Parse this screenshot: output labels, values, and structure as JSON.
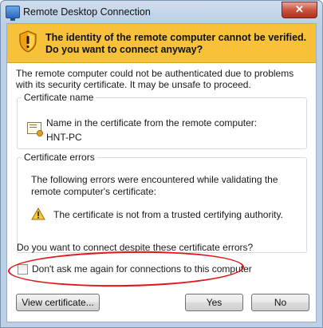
{
  "window": {
    "title": "Remote Desktop Connection",
    "close_glyph": "✕"
  },
  "banner": {
    "text": "The identity of the remote computer cannot be verified. Do you want to connect anyway?",
    "icon": "warning-shield-icon",
    "color": "#f7c23a"
  },
  "intro": "The remote computer could not be authenticated due to problems with its security certificate. It may be unsafe to proceed.",
  "certificate_name": {
    "legend": "Certificate name",
    "label": "Name in the certificate from the remote computer:",
    "value": "HNT-PC"
  },
  "certificate_errors": {
    "legend": "Certificate errors",
    "description": "The following errors were encountered while validating the remote computer's certificate:",
    "error": "The certificate is not from a trusted certifying authority."
  },
  "question": "Do you want to connect despite these certificate errors?",
  "checkbox": {
    "label": "Don't ask me again for connections to this computer",
    "checked": false
  },
  "buttons": {
    "view_certificate": "View certificate...",
    "yes": "Yes",
    "no": "No"
  },
  "annotation_color": "#e0161a"
}
